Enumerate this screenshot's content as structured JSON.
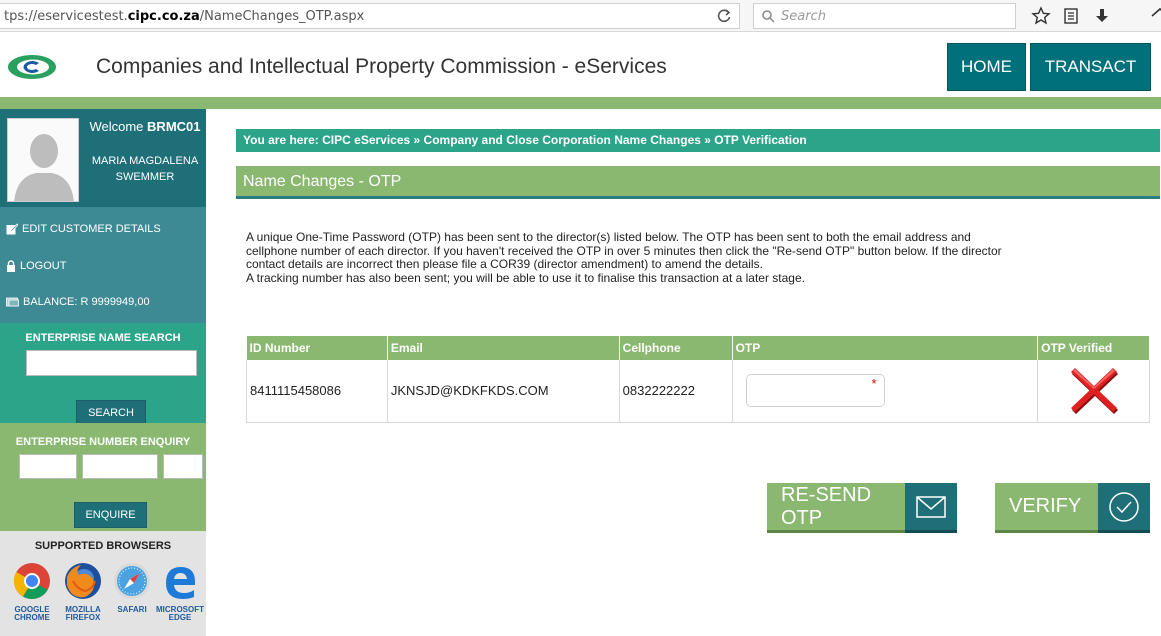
{
  "browser": {
    "url_prefix": "tps://eservicestest.",
    "url_domain": "cipc.co.za",
    "url_path": "/NameChanges_OTP.aspx",
    "search_placeholder": "Search"
  },
  "header": {
    "title": "Companies and Intellectual Property Commission - eServices",
    "nav": {
      "home": "HOME",
      "transact": "TRANSACT"
    }
  },
  "sidebar": {
    "welcome_label": "Welcome",
    "username": "BRMC01",
    "full_name_line1": "MARIA MAGDALENA",
    "full_name_line2": "SWEMMER",
    "menu": {
      "edit": "EDIT CUSTOMER DETAILS",
      "logout": "LOGOUT",
      "balance": "BALANCE: R 9999949,00"
    },
    "name_search": {
      "title": "ENTERPRISE NAME SEARCH",
      "button": "SEARCH"
    },
    "number_enquiry": {
      "title": "ENTERPRISE NUMBER ENQUIRY",
      "button": "ENQUIRE"
    },
    "browsers": {
      "title": "SUPPORTED BROWSERS",
      "chrome_l1": "GOOGLE",
      "chrome_l2": "CHROME",
      "firefox_l1": "MOZILLA",
      "firefox_l2": "FIREFOX",
      "safari_l1": "SAFARI",
      "safari_l2": "",
      "edge_l1": "MICROSOFT",
      "edge_l2": "EDGE"
    }
  },
  "main": {
    "breadcrumb": "You are here: CIPC eServices » Company and Close Corporation Name Changes » OTP Verification",
    "page_title": "Name Changes - OTP",
    "intro_line1": "A unique One-Time Password (OTP) has been sent to the director(s) listed below. The OTP has been sent to both the email address and",
    "intro_line2": "cellphone number of each director. If you haven't received the OTP in over 5 minutes then click the \"Re-send OTP\" button below. If the director",
    "intro_line3": "contact details are incorrect then please file a COR39 (director amendment) to amend the details.",
    "intro_line4": "A tracking number has also been sent; you will be able to use it to finalise this transaction at a later stage.",
    "table": {
      "headers": [
        "ID Number",
        "Email",
        "Cellphone",
        "OTP",
        "OTP Verified"
      ],
      "rows": [
        {
          "id_number": "8411115458086",
          "email": "JKNSJD@KDKFKDS.COM",
          "cellphone": "0832222222",
          "otp": "",
          "verified_icon": "red-cross-icon"
        }
      ]
    },
    "buttons": {
      "resend": "RE-SEND OTP",
      "verify": "VERIFY"
    }
  },
  "colors": {
    "teal_dark": "#1f6f78",
    "teal": "#2ba489",
    "green": "#8ab870",
    "nav": "#00707a"
  }
}
